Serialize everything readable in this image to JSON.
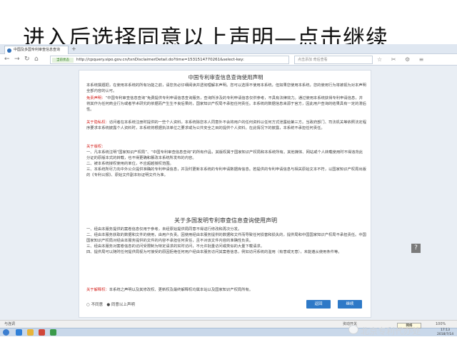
{
  "slide": {
    "title": "进入后选择同意以上声明—点击继续"
  },
  "browser": {
    "tab_title": "中国及多国专利审查信息查询",
    "new_tab": "+",
    "secure_label": "当前状态",
    "url": "http://cpquery.sipo.gov.cn/txnDisclaimerDetail.do?time=1531514770261&select-key:",
    "search_placeholder": "点击添加 奇后查看",
    "status_left": "与连调",
    "status_mid": "资动开关",
    "status_right": "100%"
  },
  "page": {
    "title1": "中国专利审查信息查询使用声明",
    "p1": "本系统撰题把，在使用本系统的所有功能之前，请您务必仔细阅读并透彻理解本声明。您可以选择不使用本系统，但如果您使用本系统，您的使用行为将被视为对本声明全部内容的认可。",
    "p2_label": "免责声明：",
    "p2": "“中国专利审查信息查询”免费提供专利申请信息查询服务，查询所涉及的专利申请信息仅供参考，不具有法律效力。通过使用本系统获得专利申请信息，并将其作为任何商业行为或者学术研究的依据而产生生不良后果的，国家知识产权局不承担任何责任。本系统的数据信息来源于官方，因此用户查询的结果具有一定的滞后性。",
    "p3_label": "关于隐私权：",
    "p3": "访问者在本系统注册时提供的一些个人资料，本系统除您本人同意外不会将用户的任何资料以任何方式泄露给第三方。当政府部门、司法机关等依照法定程序要求本系统披露个人资料时，本系统将根据执法单位之要求或为公共安全之目的提供个人资料。在此情况下的披露，本系统不承担任何责任。",
    "p4_label": "关于版权：",
    "p4": "一、凡本系统注明“国家知识产权局”、“中国专利审查信息查询”的所有作品，其版权属于国家知识产权局和本系统所有。其他媒体、网站或个人转载使用时不得违背此分证的原版本式的转载，也不得更确和篡改本系统所发布的内容。\n二、被本系统授权使用的单位，不应超越授权范围。\n三、本系统所尽力向中外公众提供准确的专利申请信息，并及时更新本系统的专利申请数据库信息。若提供的专利申请信息与相关原始文本不符，以国家知识产权局出版的《专利公报》、原始文件副本标证明文件为准。",
    "title2": "关于多国发明专利审查信息查询使用声明",
    "p5": "一、经由本服务提供的案卷信息仅用于参考，未经原始提供局同意不得进行修改和再次分发。\n二、经由本服务获取的数据和文件的使用，由用户负责。因使用经由本服务提供的数据和文件而导致任何损害和损失的，提供局和中国国家知识产权局不承担责任。中国国家知识产权局对经由本服务提供的文件的内容不承担任何责任，且不对该文件内容的准确性负责。\n三、经由本服务对案卷信息的访问受限制为特定请求的实时访问，不允许批量访问或类似的大量下载请求。\n四、提供局可以随时任何提供局视为可接受的原因拒绝任何用户经由本服务访问其案卷信息，例如访问系统的滥用（有意或无意），未能遵从使用条件等。",
    "p6_label": "关于解释权：",
    "p6": "本系统之声明以及其修改权、更新权及最终解释权均属本站以及国家知识产权局所有。",
    "choice_disagree": "不同意",
    "choice_agree": "同意以上声明",
    "btn_back": "返回",
    "btn_continue": "继续",
    "help": "?"
  },
  "taskbar": {
    "time": "17:13",
    "date": "2018/7/14",
    "tooltip": "网络"
  },
  "watermark": "北京专利代办处",
  "colors": {
    "accent": "#2e79c7",
    "warning": "#d4201b"
  }
}
